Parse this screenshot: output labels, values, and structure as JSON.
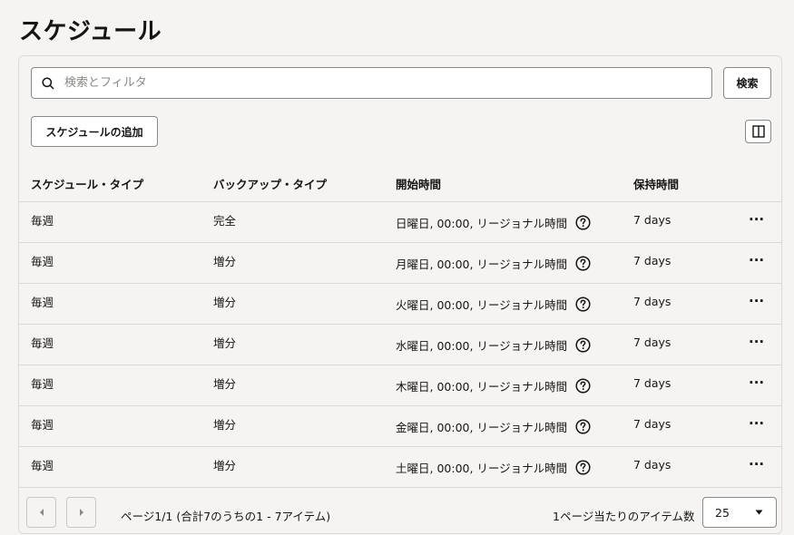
{
  "page": {
    "title": "スケジュール"
  },
  "search": {
    "placeholder": "検索とフィルタ",
    "button_label": "検索"
  },
  "toolbar": {
    "add_label": "スケジュールの追加",
    "panel_icon": "split-panel-icon"
  },
  "table": {
    "columns": [
      "スケジュール・タイプ",
      "バックアップ・タイプ",
      "開始時間",
      "保持時間"
    ],
    "rows": [
      {
        "schedule_type": "毎週",
        "backup_type": "完全",
        "start_time": "日曜日, 00:00, リージョナル時間",
        "retention": "7 days"
      },
      {
        "schedule_type": "毎週",
        "backup_type": "増分",
        "start_time": "月曜日, 00:00, リージョナル時間",
        "retention": "7 days"
      },
      {
        "schedule_type": "毎週",
        "backup_type": "増分",
        "start_time": "火曜日, 00:00, リージョナル時間",
        "retention": "7 days"
      },
      {
        "schedule_type": "毎週",
        "backup_type": "増分",
        "start_time": "水曜日, 00:00, リージョナル時間",
        "retention": "7 days"
      },
      {
        "schedule_type": "毎週",
        "backup_type": "増分",
        "start_time": "木曜日, 00:00, リージョナル時間",
        "retention": "7 days"
      },
      {
        "schedule_type": "毎週",
        "backup_type": "増分",
        "start_time": "金曜日, 00:00, リージョナル時間",
        "retention": "7 days"
      },
      {
        "schedule_type": "毎週",
        "backup_type": "増分",
        "start_time": "土曜日, 00:00, リージョナル時間",
        "retention": "7 days"
      }
    ],
    "row_menu_label": "···"
  },
  "pagination": {
    "info": "ページ1/1 (合計7のうちの1 - 7アイテム)",
    "per_page_label": "1ページ当たりのアイテム数",
    "per_page_value": "25"
  }
}
